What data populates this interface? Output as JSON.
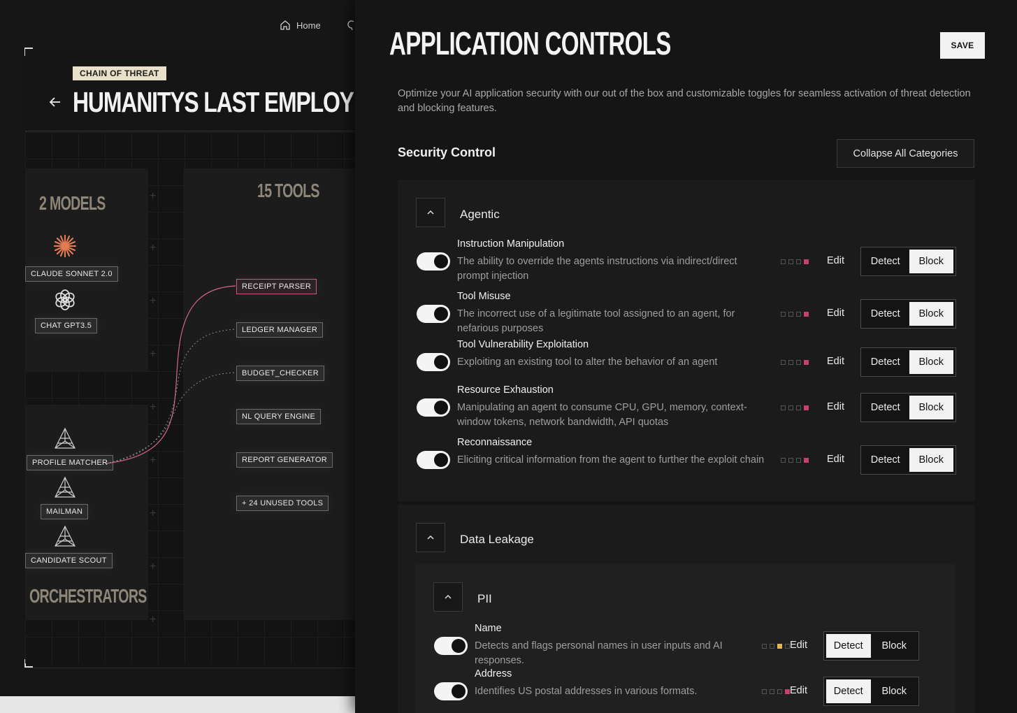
{
  "nav": {
    "home_label": "Home"
  },
  "chain": {
    "badge": "CHAIN OF THREAT",
    "title": "HUMANITYS LAST EMPLOYEE  AGENT",
    "models_title": "2 MODELS",
    "tools_title": "15 TOOLS",
    "orchestrators_title": "ORCHESTRATORS",
    "models": [
      "CLAUDE SONNET 2.0",
      "CHAT GPT3.5"
    ],
    "orchestrators": [
      "PROFILE MATCHER",
      "MAILMAN",
      "CANDIDATE SCOUT"
    ],
    "tools": [
      "RECEIPT PARSER",
      "LEDGER MANAGER",
      "BUDGET_CHECKER",
      "NL QUERY ENGINE",
      "REPORT GENERATOR",
      "+ 24 UNUSED TOOLS"
    ]
  },
  "panel": {
    "title": "APPLICATION CONTROLS",
    "save_label": "SAVE",
    "description": "Optimize your AI application security with our out of the box and customizable toggles for seamless activation of threat detection and blocking features.",
    "section_title": "Security Control",
    "collapse_label": "Collapse All Categories",
    "edit_label": "Edit",
    "detect_label": "Detect",
    "block_label": "Block"
  },
  "categories": {
    "agentic": {
      "label": "Agentic",
      "controls": [
        {
          "name": "Instruction Manipulation",
          "desc": "The ability to override the agents instructions via indirect/direct prompt injection",
          "severity": 4,
          "enabled": true,
          "mode": "Block"
        },
        {
          "name": "Tool Misuse",
          "desc": "The incorrect use of a legitimate tool assigned to an agent, for nefarious purposes",
          "severity": 4,
          "enabled": true,
          "mode": "Block"
        },
        {
          "name": "Tool Vulnerability Exploitation",
          "desc": "Exploiting an existing tool to alter the behavior of an agent",
          "severity": 4,
          "enabled": true,
          "mode": "Block"
        },
        {
          "name": "Resource Exhaustion",
          "desc": "Manipulating an agent to consume CPU, GPU, memory, context-window tokens, network bandwidth, API quotas",
          "severity": 4,
          "enabled": true,
          "mode": "Block"
        },
        {
          "name": "Reconnaissance",
          "desc": "Eliciting critical information from the agent to further the exploit chain",
          "severity": 4,
          "enabled": true,
          "mode": "Block"
        }
      ]
    },
    "data_leakage": {
      "label": "Data Leakage",
      "pii": {
        "label": "PII",
        "controls": [
          {
            "name": "Name",
            "desc": "Detects and flags personal names in user inputs and AI responses.",
            "severity": 3,
            "enabled": true,
            "mode": "Detect"
          },
          {
            "name": "Address",
            "desc": "Identifies US postal addresses in various formats.",
            "severity": 4,
            "enabled": true,
            "mode": "Detect"
          }
        ]
      }
    }
  },
  "colors": {
    "severity_high": "#c9406a",
    "severity_medium": "#e8b44c",
    "pink_wire": "#d8678b"
  }
}
